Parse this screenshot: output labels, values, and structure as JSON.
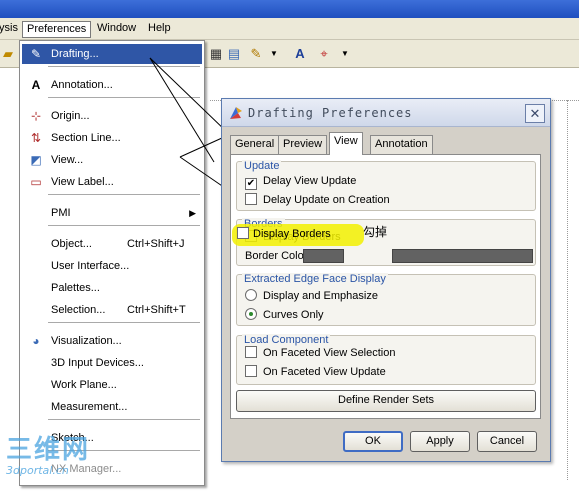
{
  "menubar": {
    "items": [
      "ysis",
      "Preferences",
      "Window",
      "Help"
    ]
  },
  "dropdown": {
    "items": [
      {
        "label": "Drafting...",
        "shortcut": ""
      },
      {
        "label": "Annotation...",
        "shortcut": ""
      },
      {
        "label": "Origin...",
        "shortcut": ""
      },
      {
        "label": "Section Line...",
        "shortcut": ""
      },
      {
        "label": "View...",
        "shortcut": ""
      },
      {
        "label": "View Label...",
        "shortcut": ""
      },
      {
        "label": "PMI",
        "shortcut": ""
      },
      {
        "label": "Object...",
        "shortcut": "Ctrl+Shift+J"
      },
      {
        "label": "User Interface...",
        "shortcut": ""
      },
      {
        "label": "Palettes...",
        "shortcut": ""
      },
      {
        "label": "Selection...",
        "shortcut": "Ctrl+Shift+T"
      },
      {
        "label": "Visualization...",
        "shortcut": ""
      },
      {
        "label": "3D Input Devices...",
        "shortcut": ""
      },
      {
        "label": "Work Plane...",
        "shortcut": ""
      },
      {
        "label": "Measurement...",
        "shortcut": ""
      },
      {
        "label": "Sketch...",
        "shortcut": ""
      },
      {
        "label": "NX Manager...",
        "shortcut": ""
      }
    ]
  },
  "dialog": {
    "title": "Drafting Preferences",
    "tabs": [
      "General",
      "Preview",
      "View",
      "Annotation"
    ],
    "active_tab": "View",
    "update": {
      "label": "Update",
      "delay_view_update": {
        "label": "Delay View Update",
        "checked": true
      },
      "delay_update_on_creation": {
        "label": "Delay Update on Creation",
        "checked": false
      }
    },
    "borders": {
      "label": "Borders",
      "display_borders": {
        "label": "Display Borders",
        "checked": false
      },
      "border_color_label": "Border Color",
      "border_color": "#626262"
    },
    "extracted_edge": {
      "label": "Extracted Edge Face Display",
      "options": [
        "Display and Emphasize",
        "Curves Only"
      ],
      "selected": "Curves Only"
    },
    "load_component": {
      "label": "Load Component",
      "on_faceted_view_selection": {
        "label": "On Faceted View Selection",
        "checked": false
      },
      "on_faceted_view_update": {
        "label": "On Faceted View Update",
        "checked": false
      }
    },
    "define_render_sets": "Define Render Sets",
    "buttons": {
      "ok": "OK",
      "apply": "Apply",
      "cancel": "Cancel"
    }
  },
  "annotation_note": "勾掉",
  "watermark": {
    "big": "三维网",
    "small": "3dportal.cn"
  },
  "colors": {
    "accent": "#2f56a6",
    "highlight": "#f2f000"
  }
}
